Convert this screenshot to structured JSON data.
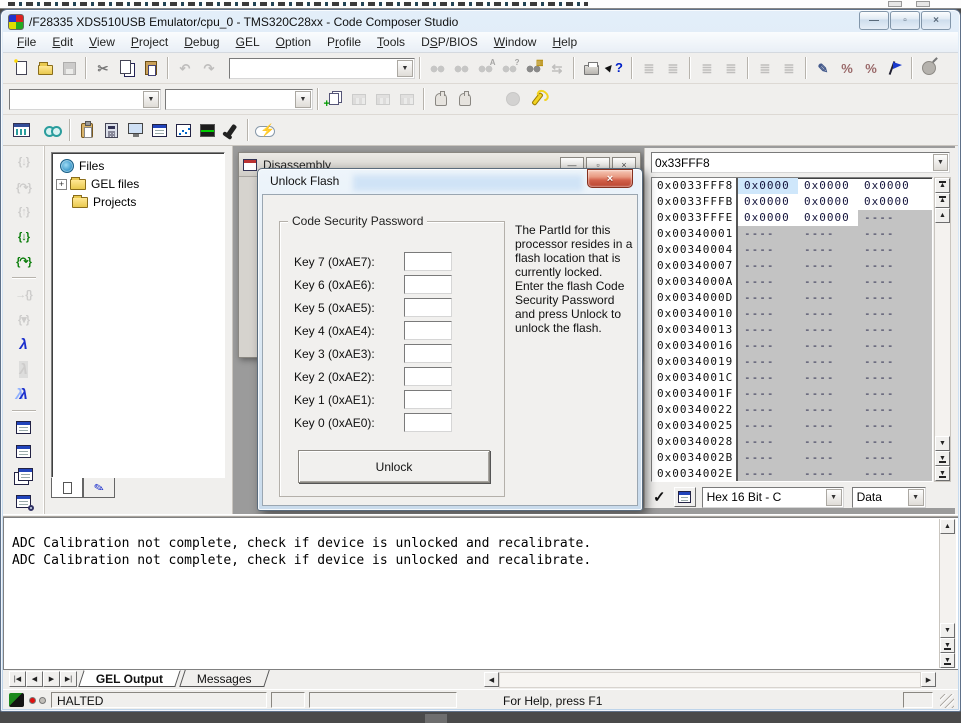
{
  "window": {
    "title": "/F28335 XDS510USB Emulator/cpu_0 - TMS320C28xx - Code Composer Studio"
  },
  "menu": {
    "items": [
      {
        "label": "File",
        "u": 0
      },
      {
        "label": "Edit",
        "u": 0
      },
      {
        "label": "View",
        "u": 0
      },
      {
        "label": "Project",
        "u": 0
      },
      {
        "label": "Debug",
        "u": 0
      },
      {
        "label": "GEL",
        "u": 0
      },
      {
        "label": "Option",
        "u": 0
      },
      {
        "label": "Profile",
        "u": 1
      },
      {
        "label": "Tools",
        "u": 0
      },
      {
        "label": "DSP/BIOS",
        "u": 1
      },
      {
        "label": "Window",
        "u": 0
      },
      {
        "label": "Help",
        "u": 0
      }
    ]
  },
  "icons": {
    "minimize": "—",
    "restore": "▫",
    "close": "×",
    "cut": "✂",
    "undo": "↶",
    "redo": "↷",
    "replace": "⇆",
    "cursor": "▶",
    "question": "?",
    "lines": "≣",
    "percent": "%",
    "pen": "✎",
    "bolt": "⚡",
    "check": "✓",
    "plus": "+",
    "up": "▲",
    "down": "▼",
    "left": "◀",
    "right": "▶",
    "first": "|◀",
    "prev": "◀",
    "next": "▶",
    "last": "▶|",
    "step_into": "{↓}",
    "step_over": "{↷}",
    "step_out": "{↑}",
    "run_to_cursor": "→{}",
    "set_pc": "{▾}",
    "lambda": "λ"
  },
  "files_panel": {
    "root": "Files",
    "items": [
      {
        "label": "GEL files",
        "expandable": true
      },
      {
        "label": "Projects",
        "expandable": false
      }
    ]
  },
  "disassembly": {
    "title": "Disassembly"
  },
  "dialog": {
    "title": "Unlock Flash",
    "group_title": "Code Security Password",
    "keys": [
      "Key 7 (0xAE7):",
      "Key 6 (0xAE6):",
      "Key 5 (0xAE5):",
      "Key 4 (0xAE4):",
      "Key 3 (0xAE3):",
      "Key 2 (0xAE2):",
      "Key 1 (0xAE1):",
      "Key 0 (0xAE0):"
    ],
    "info1": "The PartId for this processor resides in a flash location that is currently locked.",
    "info2": "Enter the flash Code Security Password and press Unlock to unlock the flash.",
    "unlock_label": "Unlock"
  },
  "memory": {
    "address": "0x33FFF8",
    "format": "Hex 16 Bit - C",
    "type": "Data",
    "rows": [
      {
        "addr": "0x0033FFF8",
        "vals": [
          "0x0000",
          "0x0000",
          "0x0000"
        ],
        "grayFrom": 4,
        "sel": 0
      },
      {
        "addr": "0x0033FFFB",
        "vals": [
          "0x0000",
          "0x0000",
          "0x0000"
        ],
        "grayFrom": 4,
        "sel": -1
      },
      {
        "addr": "0x0033FFFE",
        "vals": [
          "0x0000",
          "0x0000",
          "----"
        ],
        "grayFrom": 2,
        "sel": -1
      },
      {
        "addr": "0x00340001",
        "vals": [
          "----",
          "----",
          "----"
        ],
        "grayFrom": 0,
        "sel": -1
      },
      {
        "addr": "0x00340004",
        "vals": [
          "----",
          "----",
          "----"
        ],
        "grayFrom": 0,
        "sel": -1
      },
      {
        "addr": "0x00340007",
        "vals": [
          "----",
          "----",
          "----"
        ],
        "grayFrom": 0,
        "sel": -1
      },
      {
        "addr": "0x0034000A",
        "vals": [
          "----",
          "----",
          "----"
        ],
        "grayFrom": 0,
        "sel": -1
      },
      {
        "addr": "0x0034000D",
        "vals": [
          "----",
          "----",
          "----"
        ],
        "grayFrom": 0,
        "sel": -1
      },
      {
        "addr": "0x00340010",
        "vals": [
          "----",
          "----",
          "----"
        ],
        "grayFrom": 0,
        "sel": -1
      },
      {
        "addr": "0x00340013",
        "vals": [
          "----",
          "----",
          "----"
        ],
        "grayFrom": 0,
        "sel": -1
      },
      {
        "addr": "0x00340016",
        "vals": [
          "----",
          "----",
          "----"
        ],
        "grayFrom": 0,
        "sel": -1
      },
      {
        "addr": "0x00340019",
        "vals": [
          "----",
          "----",
          "----"
        ],
        "grayFrom": 0,
        "sel": -1
      },
      {
        "addr": "0x0034001C",
        "vals": [
          "----",
          "----",
          "----"
        ],
        "grayFrom": 0,
        "sel": -1
      },
      {
        "addr": "0x0034001F",
        "vals": [
          "----",
          "----",
          "----"
        ],
        "grayFrom": 0,
        "sel": -1
      },
      {
        "addr": "0x00340022",
        "vals": [
          "----",
          "----",
          "----"
        ],
        "grayFrom": 0,
        "sel": -1
      },
      {
        "addr": "0x00340025",
        "vals": [
          "----",
          "----",
          "----"
        ],
        "grayFrom": 0,
        "sel": -1
      },
      {
        "addr": "0x00340028",
        "vals": [
          "----",
          "----",
          "----"
        ],
        "grayFrom": 0,
        "sel": -1
      },
      {
        "addr": "0x0034002B",
        "vals": [
          "----",
          "----",
          "----"
        ],
        "grayFrom": 0,
        "sel": -1
      },
      {
        "addr": "0x0034002E",
        "vals": [
          "----",
          "----",
          "----"
        ],
        "grayFrom": 0,
        "sel": -1
      }
    ]
  },
  "output": {
    "lines": [
      "ADC Calibration not complete, check if device is unlocked and recalibrate.",
      "ADC Calibration not complete, check if device is unlocked and recalibrate."
    ],
    "tabs": [
      {
        "label": "GEL Output",
        "active": true
      },
      {
        "label": "Messages",
        "active": false
      }
    ]
  },
  "status": {
    "state": "HALTED",
    "help": "For Help, press F1"
  },
  "colors": {
    "close_button": "#d2604a",
    "selection": "#cfe7fb",
    "memory_gray": "#c3c3c3",
    "titlebar": "#cfe0f1"
  }
}
